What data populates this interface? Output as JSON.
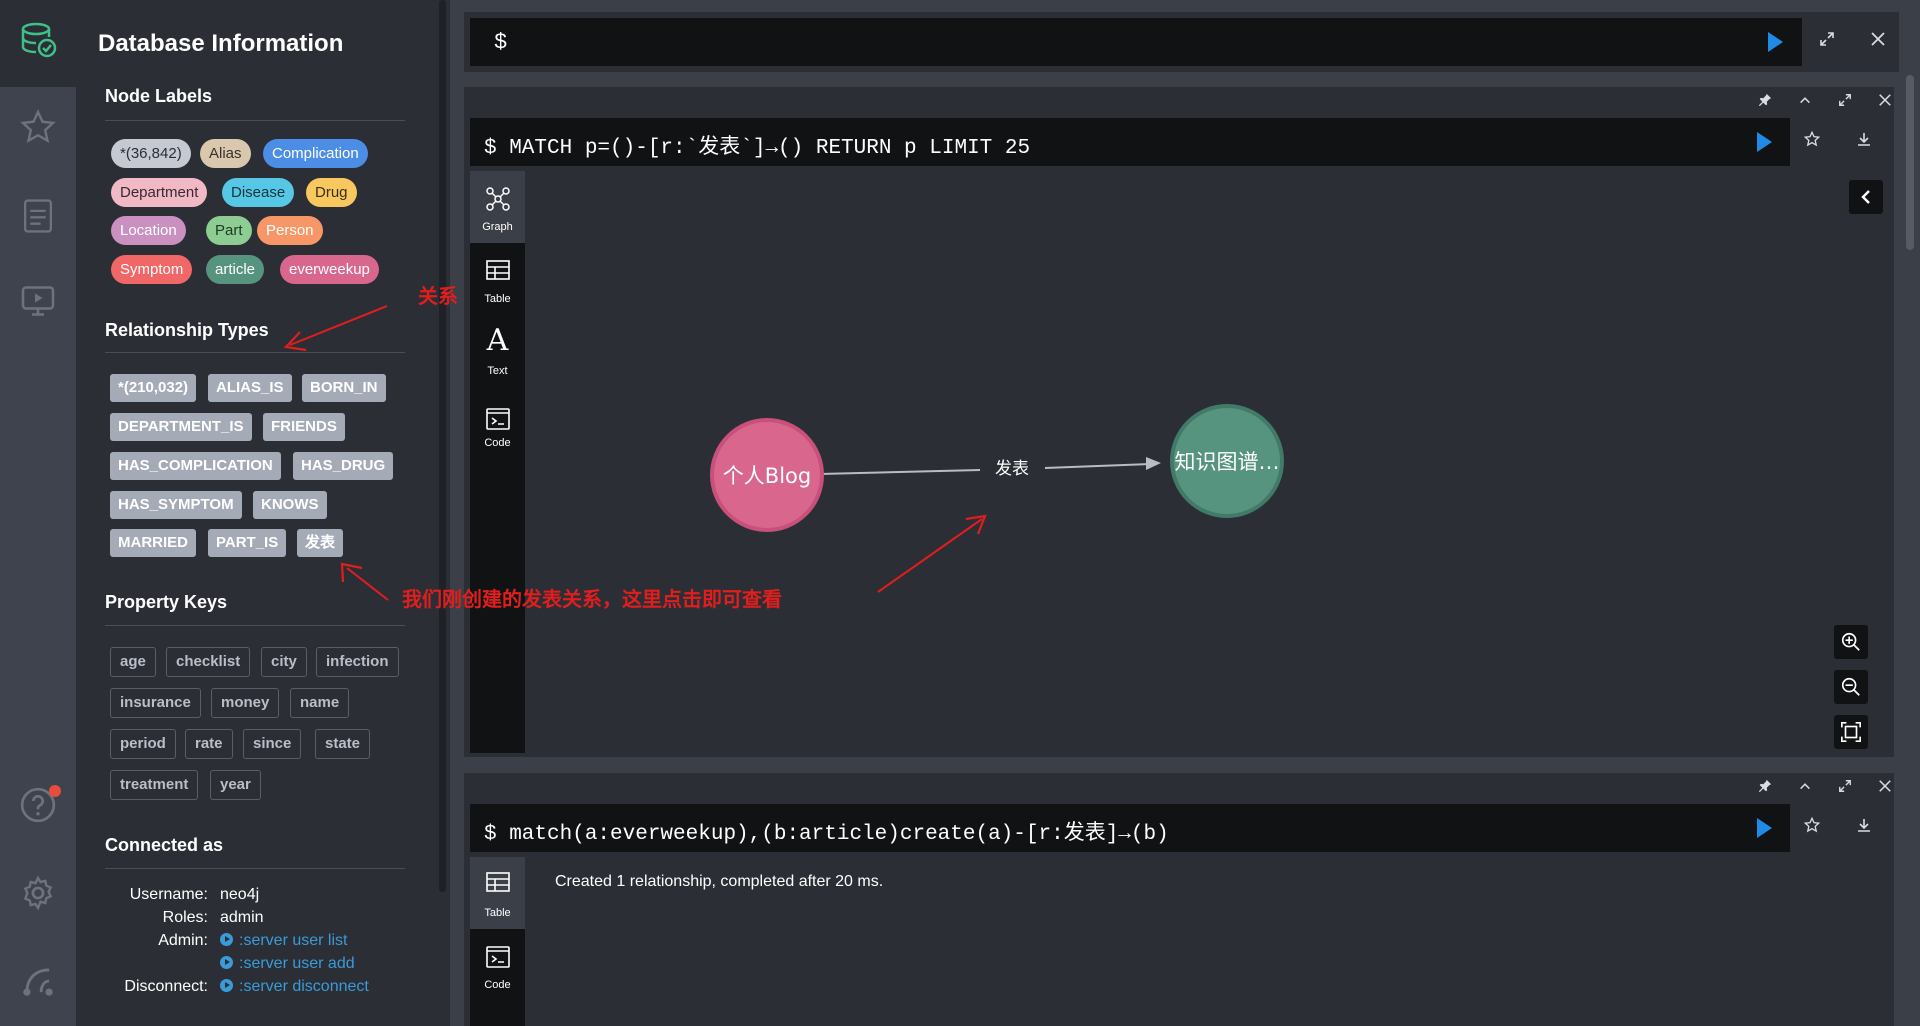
{
  "drawer": {
    "title": "Database Information",
    "node_labels": {
      "heading": "Node Labels",
      "items": [
        {
          "label": "*(36,842)",
          "bg": "#c5c9d1",
          "fg": "#2b2e35"
        },
        {
          "label": "Alias",
          "bg": "#d9c8ae",
          "fg": "#3a3128"
        },
        {
          "label": "Complication",
          "bg": "#4c8ee6",
          "fg": "#ffffff"
        },
        {
          "label": "Department",
          "bg": "#f1b8c6",
          "fg": "#3a2a2f"
        },
        {
          "label": "Disease",
          "bg": "#56c7e4",
          "fg": "#16353e"
        },
        {
          "label": "Drug",
          "bg": "#f7c85d",
          "fg": "#3a2f14"
        },
        {
          "label": "Location",
          "bg": "#c990c0",
          "fg": "#ffffff"
        },
        {
          "label": "Part",
          "bg": "#8dcc93",
          "fg": "#1f3a22"
        },
        {
          "label": "Person",
          "bg": "#f79767",
          "fg": "#ffffff"
        },
        {
          "label": "Symptom",
          "bg": "#f16667",
          "fg": "#ffffff"
        },
        {
          "label": "article",
          "bg": "#569480",
          "fg": "#ffffff"
        },
        {
          "label": "everweekup",
          "bg": "#d9668c",
          "fg": "#ffffff"
        }
      ]
    },
    "relationship_types": {
      "heading": "Relationship Types",
      "items": [
        "*(210,032)",
        "ALIAS_IS",
        "BORN_IN",
        "DEPARTMENT_IS",
        "FRIENDS",
        "HAS_COMPLICATION",
        "HAS_DRUG",
        "HAS_SYMPTOM",
        "KNOWS",
        "MARRIED",
        "PART_IS",
        "发表"
      ]
    },
    "property_keys": {
      "heading": "Property Keys",
      "items": [
        "age",
        "checklist",
        "city",
        "infection",
        "insurance",
        "money",
        "name",
        "period",
        "rate",
        "since",
        "state",
        "treatment",
        "year"
      ]
    },
    "connected_as": {
      "heading": "Connected as",
      "username_label": "Username:",
      "username": "neo4j",
      "roles_label": "Roles:",
      "roles": "admin",
      "admin_label": "Admin:",
      "admin_link1": ":server user list",
      "admin_link2": ":server user add",
      "disconnect_label": "Disconnect:",
      "disconnect_link": ":server disconnect"
    }
  },
  "annotations": {
    "relation": "关系",
    "created": "我们刚创建的发表关系，这里点击即可查看"
  },
  "editor": {
    "prompt": "$"
  },
  "frame1": {
    "query": "$ MATCH p=()-[r:`发表`]→() RETURN p LIMIT 25",
    "tabs": [
      "Graph",
      "Table",
      "Text",
      "Code"
    ],
    "graph": {
      "node_a": {
        "label": "个人Blog",
        "color": "#d9668c"
      },
      "node_b": {
        "label": "知识图谱…",
        "color": "#569480"
      },
      "rel_label": "发表"
    }
  },
  "frame2": {
    "query": "$ match(a:everweekup),(b:article)create(a)-[r:发表]→(b)",
    "tabs": [
      "Table",
      "Code"
    ],
    "result": "Created 1 relationship, completed after 20 ms."
  },
  "colors": {
    "accent": "#1f8be6",
    "badge": "#e74c3c",
    "annotation": "#e01e1e"
  }
}
